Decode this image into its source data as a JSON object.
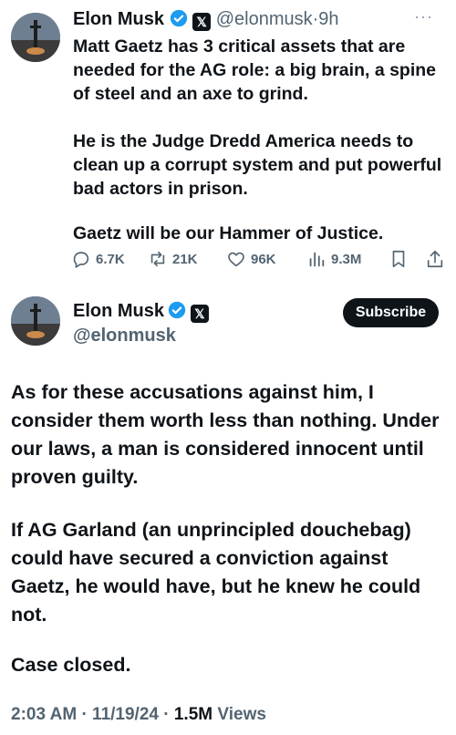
{
  "tweet1": {
    "author_name": "Elon Musk",
    "handle": "@elonmusk",
    "separator": "·",
    "time": "9h",
    "paragraphs": [
      "Matt Gaetz has 3 critical assets that are needed for the AG role: a big brain, a spine of steel and an axe to grind.",
      "He is the Judge Dredd America needs to clean up a corrupt system and put powerful bad actors in prison.",
      "Gaetz will be our Hammer of Justice."
    ],
    "actions": {
      "replies": "6.7K",
      "reposts": "21K",
      "likes": "96K",
      "views": "9.3M"
    }
  },
  "tweet2": {
    "author_name": "Elon Musk",
    "handle": "@elonmusk",
    "subscribe_label": "Subscribe",
    "paragraphs": [
      "As for these accusations against him, I consider them worth less than nothing. Under our laws, a man is considered innocent until proven guilty.",
      "If AG Garland (an unprincipled douchebag) could have secured a conviction against Gaetz, he would have, but he knew he could not.",
      "Case closed."
    ],
    "time": "2:03 AM",
    "date": "11/19/24",
    "separator": "·",
    "views_count": "1.5M",
    "views_label": "Views"
  },
  "icons": {
    "verified": "verified-badge-icon",
    "affiliate": "x-logo-icon",
    "more": "more-icon",
    "reply": "reply-icon",
    "repost": "repost-icon",
    "like": "like-icon",
    "views": "views-icon",
    "bookmark": "bookmark-icon",
    "share": "share-icon"
  },
  "colors": {
    "text": "#0f1419",
    "muted": "#536471",
    "verified": "#1d9bf0",
    "subscribe_bg": "#0f1419"
  }
}
